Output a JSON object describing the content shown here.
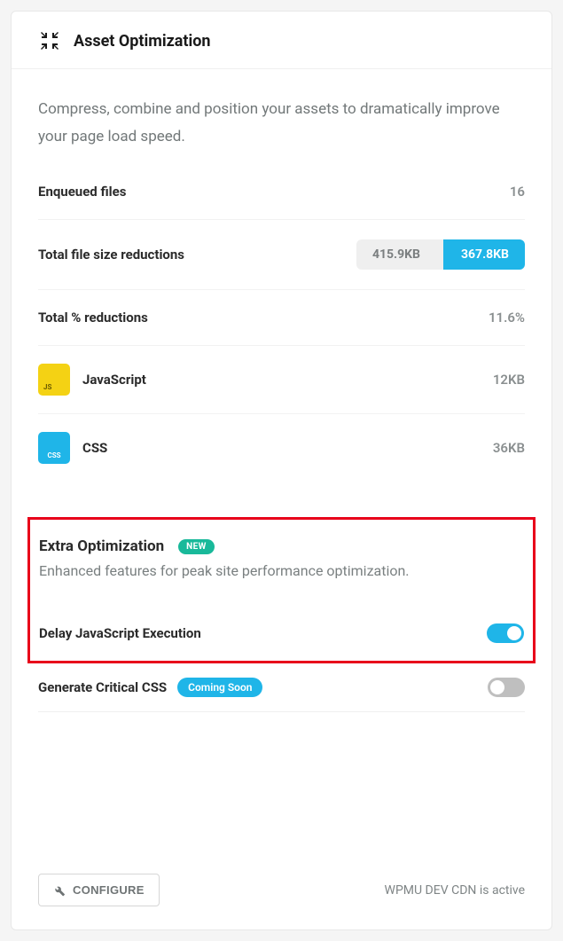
{
  "header": {
    "title": "Asset Optimization"
  },
  "description": "Compress, combine and position your assets to dramatically improve your page load speed.",
  "stats": {
    "enqueued_label": "Enqueued files",
    "enqueued_value": "16",
    "size_label": "Total file size reductions",
    "size_before": "415.9KB",
    "size_after": "367.8KB",
    "percent_label": "Total % reductions",
    "percent_value": "11.6%"
  },
  "assets": {
    "js_name": "JavaScript",
    "js_size": "12KB",
    "css_name": "CSS",
    "css_size": "36KB"
  },
  "extra": {
    "title": "Extra Optimization",
    "badge": "NEW",
    "description": "Enhanced features for peak site performance optimization.",
    "delay_label": "Delay JavaScript Execution",
    "critical_label": "Generate Critical CSS",
    "coming_badge": "Coming Soon"
  },
  "footer": {
    "configure": "CONFIGURE",
    "cdn_status": "WPMU DEV CDN is active"
  }
}
